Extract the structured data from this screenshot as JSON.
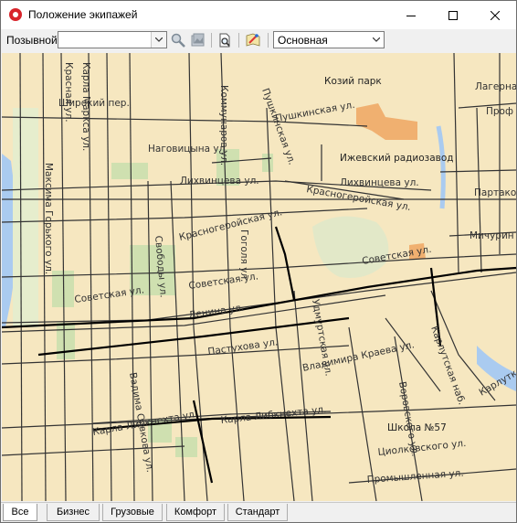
{
  "window": {
    "title": "Положение экипажей"
  },
  "toolbar": {
    "callsign_label": "Позывной:",
    "callsign_value": "",
    "layer_value": "Основная"
  },
  "icons": {
    "app": "record-icon",
    "find": "magnifier-icon",
    "gallery": "image-icon",
    "preview": "print-preview-icon",
    "settings": "map-edit-icon"
  },
  "map": {
    "labels": {
      "kirov_park": "Козий парк",
      "radio_factory": "Ижевский радиозавод",
      "school": "Школа №57",
      "shirokiy": "Широкий пер.",
      "kommunarov": "Коммунаров ул.",
      "pushkinskaya_top": "Пушкинская ул.",
      "nagovitsyna": "Наговицына ул.",
      "pushkinskaya_mid": "Пушкинская ул.",
      "lihvintseva_w": "Лихвинцева ул.",
      "lihvintseva_e": "Лихвинцева ул.",
      "krasnogeroiskaya_e": "Красногеройская ул.",
      "krasnogeroiskaya_w": "Красногеройская ул.",
      "gogolya": "Гоголя ул.",
      "sovetskaya_w": "Советская ул.",
      "sovetskaya_mid": "Советская ул.",
      "sovetskaya_e": "Советская ул.",
      "leninа": "Ленина ул.",
      "pastukhova": "Пастухова ул.",
      "udmurtskaya": "Удмуртская ул.",
      "vladimira_krasnova": "Владимира Краева ул.",
      "karla_libknekhta": "Карла Либкнехта ул.",
      "karla_libknekhta2": "Карла Либкнехта ул.",
      "karla_marksa": "Карла Маркса ул.",
      "maksima_gorkogo": "Максима Горького ул.",
      "krasnaya": "Красная ул.",
      "promyshlennaya": "Промышленная ул.",
      "tsiolkovskogo": "Циолковского ул.",
      "vorovskogo": "Воровского ул.",
      "lagernaya": "Лагерная",
      "prof": "Проф",
      "partakov": "Партаков",
      "minuril": "Мичурин",
      "karlutka": "Карлутка",
      "nabertnaya": "Карлутская наб.",
      "svobody": "Свободы ул.",
      "vadima_sivkova": "Вадима Сивкова ул."
    }
  },
  "tabs": [
    {
      "label": "Все",
      "active": true
    },
    {
      "label": "Бизнес",
      "active": false
    },
    {
      "label": "Грузовые",
      "active": false
    },
    {
      "label": "Комфорт",
      "active": false
    },
    {
      "label": "Стандарт",
      "active": false
    }
  ]
}
